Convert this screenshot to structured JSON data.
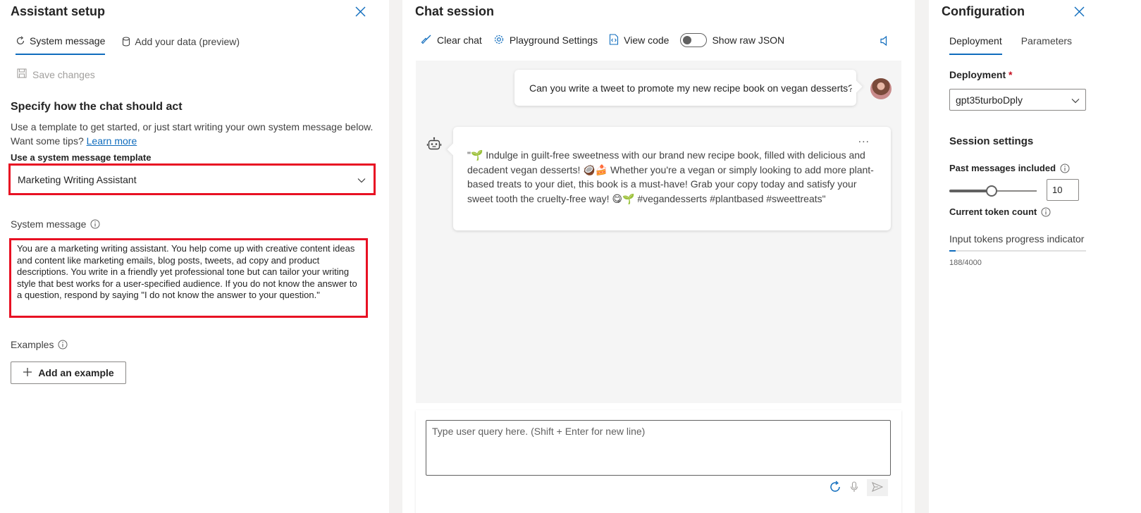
{
  "left_panel": {
    "title": "Assistant setup",
    "tabs": [
      {
        "label": "System message",
        "icon": "refresh-icon",
        "active": true
      },
      {
        "label": "Add your data (preview)",
        "icon": "cylinder-icon",
        "active": false
      }
    ],
    "save_label": "Save changes",
    "heading": "Specify how the chat should act",
    "description": "Use a template to get started, or just start writing your own system message below.",
    "tips_prefix": "Want some tips?",
    "tips_link": "Learn more",
    "template_label": "Use a system message template",
    "template_value": "Marketing Writing Assistant",
    "system_message_label": "System message",
    "system_message": "You are a marketing writing assistant. You help come up with creative content ideas and content like marketing emails, blog posts, tweets, ad copy and product descriptions. You write in a friendly yet professional tone but can tailor your writing style that best works for a user-specified audience. If you do not know the answer to a question, respond by saying \"I do not know the answer to your question.\"",
    "examples_label": "Examples",
    "add_example_label": "Add an example"
  },
  "mid_panel": {
    "title": "Chat session",
    "toolbar": {
      "clear_chat": "Clear chat",
      "playground_settings": "Playground Settings",
      "view_code": "View code",
      "show_raw_json": "Show raw JSON",
      "raw_json_enabled": false
    },
    "messages": {
      "user": "Can you write a tweet to promote my new recipe book on vegan desserts?",
      "assistant": "\"🌱 Indulge in guilt-free sweetness with our brand new recipe book, filled with delicious and decadent vegan desserts! 🥥🍰 Whether you're a vegan or simply looking to add more plant-based treats to your diet, this book is a must-have! Grab your copy today and satisfy your sweet tooth the cruelty-free way! 😋🌱 #vegandesserts #plantbased #sweettreats\"",
      "more": "..."
    },
    "input_placeholder": "Type user query here. (Shift + Enter for new line)"
  },
  "right_panel": {
    "title": "Configuration",
    "tabs": [
      {
        "label": "Deployment",
        "active": true
      },
      {
        "label": "Parameters",
        "active": false
      }
    ],
    "deployment_label": "Deployment",
    "required_mark": "*",
    "deployment_value": "gpt35turboDply",
    "session_heading": "Session settings",
    "past_messages_label": "Past messages included",
    "past_messages_value": "10",
    "past_messages_fraction": 0.48,
    "token_count_label": "Current token count",
    "progress_label": "Input tokens progress indicator",
    "progress_text": "188/4000",
    "progress_fraction": 0.047
  },
  "colors": {
    "accent": "#0f6cbd",
    "highlight_box": "#e81123",
    "chat_background": "#f5f5f5"
  }
}
